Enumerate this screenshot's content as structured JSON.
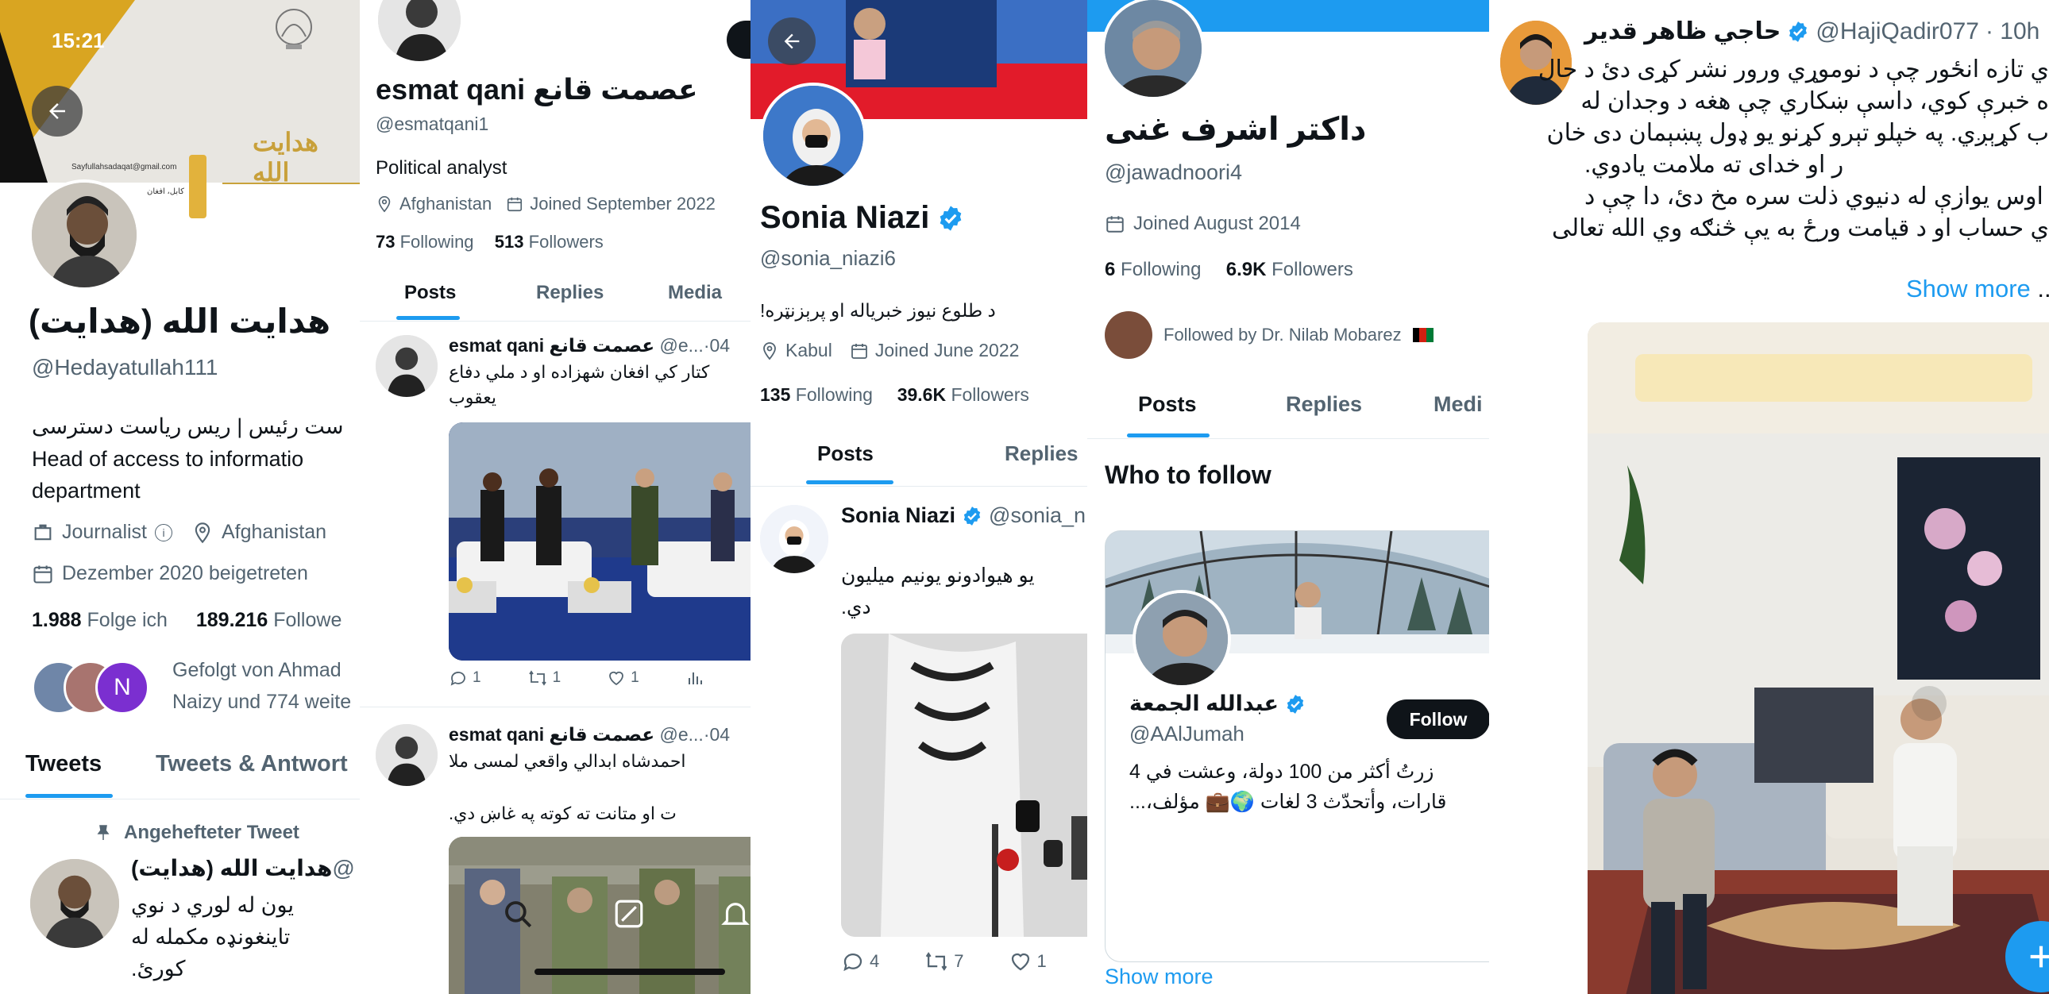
{
  "p1": {
    "status_time": "15:21",
    "banner_text": "هدایت الله",
    "banner_email": "Sayfullahsadaqat@gmail.com",
    "banner_place": "کابل، افغان",
    "name": "هدايت الله (هدايت)",
    "handle": "@Hedayatullah111",
    "bio_line1": "ست رئیس | ریس ریاست دسترسی",
    "bio_line2": "Head of access to informatio",
    "bio_line3": "department",
    "category": "Journalist",
    "location": "Afghanistan",
    "joined": "Dezember 2020 beigetreten",
    "following_count": "1.988",
    "following_label": "Folge ich",
    "followers_count": "189.216",
    "followers_label": "Followe",
    "followed_by_line1": "Gefolgt von Ahmad",
    "followed_by_line2": "Naizy und 774 weite",
    "avatar_letter": "N",
    "tabs": [
      "Tweets",
      "Tweets & Antwort"
    ],
    "pinned_label": "Angehefteter Tweet",
    "tweet_name": "هدايت الله (هدايت)",
    "tweet_handle_frag": "@",
    "tweet_line1": "یون له لوري د نوي",
    "tweet_line2": "تاینغونډه مکمله له",
    "tweet_line3": "کورئ."
  },
  "p2": {
    "name": "esmat qani عصمت قانع",
    "handle": "@esmatqani1",
    "bio": "Political analyst",
    "location": "Afghanistan",
    "joined": "Joined September 2022",
    "following_count": "73",
    "following_label": "Following",
    "followers_count": "513",
    "followers_label": "Followers",
    "tabs": [
      "Posts",
      "Replies",
      "Media"
    ],
    "tweet1": {
      "name": "esmat qani عصمت قانع",
      "handle": "@e...",
      "date": "·04",
      "line1": "کتار کي افغان شهزاده او د ملي دفاع",
      "line2": "یعقوب",
      "replies": "1",
      "reposts": "1",
      "likes": "1"
    },
    "tweet2": {
      "name": "esmat qani عصمت قانع",
      "handle": "@e...",
      "date": "·04",
      "line1": "احمدشاه ابدالي واقعي لمسی ملا",
      "line2": "ت او متانت ته کوته په غاښ دي."
    }
  },
  "p3": {
    "name": "Sonia Niazi",
    "handle": "@sonia_niazi6",
    "bio": "د طلوع نیوز خبریاله او پرېزنټره!",
    "location": "Kabul",
    "joined": "Joined June 2022",
    "following_count": "135",
    "following_label": "Following",
    "followers_count": "39.6K",
    "followers_label": "Followers",
    "tabs": [
      "Posts",
      "Replies"
    ],
    "tweet": {
      "name": "Sonia Niazi",
      "handle": "@sonia_n",
      "line1": "یو هیوادونو یونیم میلیون",
      "line2": "دي.",
      "replies": "4",
      "reposts": "7",
      "likes": "1"
    }
  },
  "p4": {
    "name": "داکتر اشرف غنی",
    "handle": "@jawadnoori4",
    "joined": "Joined August 2014",
    "following_count": "6",
    "following_label": "Following",
    "followers_count": "6.9K",
    "followers_label": "Followers",
    "followed_by": "Followed by Dr. Nilab Mobarez",
    "tabs": [
      "Posts",
      "Replies",
      "Medi"
    ],
    "who_to_follow": "Who to follow",
    "suggest_name": "عبدالله الجمعة",
    "suggest_handle": "@AAlJumah",
    "follow_button": "Follow",
    "suggest_bio_line1": "زرتُ أكثر من 100 دولة، وعشت في 4",
    "suggest_bio_line2": "قارات، وأتحدّث 3 لغات 🌍💼 مؤلف،...",
    "show_more": "Show more"
  },
  "p5": {
    "name": "حاجي ظاهر قدير",
    "handle": "@HajiQadir077",
    "time": "· 10h",
    "line1": "ي تازه انځور چې د نوموړي ورور نشر کړی دئ د حال",
    "line2": "ه خبرې کوي، داسې ښکاري چې هغه د وجدان له",
    "line3": "ب کړېږي. په خپلو تېرو کړنو یو ډول پښېمان دی خان",
    "line4": "ر او خدای ته ملامت یادوي.",
    "line5": "اوس یوازې له دنیوي ذلت سره مخ دئ، دا چې د",
    "line6": "ي حساب او د قیامت ورځ به یې څنګه وي الله تعالی",
    "line7": "...",
    "show_more": "Show more"
  },
  "colors": {
    "accent": "#1d9bf0",
    "text": "#0f1419",
    "muted": "#536471",
    "divider": "#e6ecf0"
  }
}
